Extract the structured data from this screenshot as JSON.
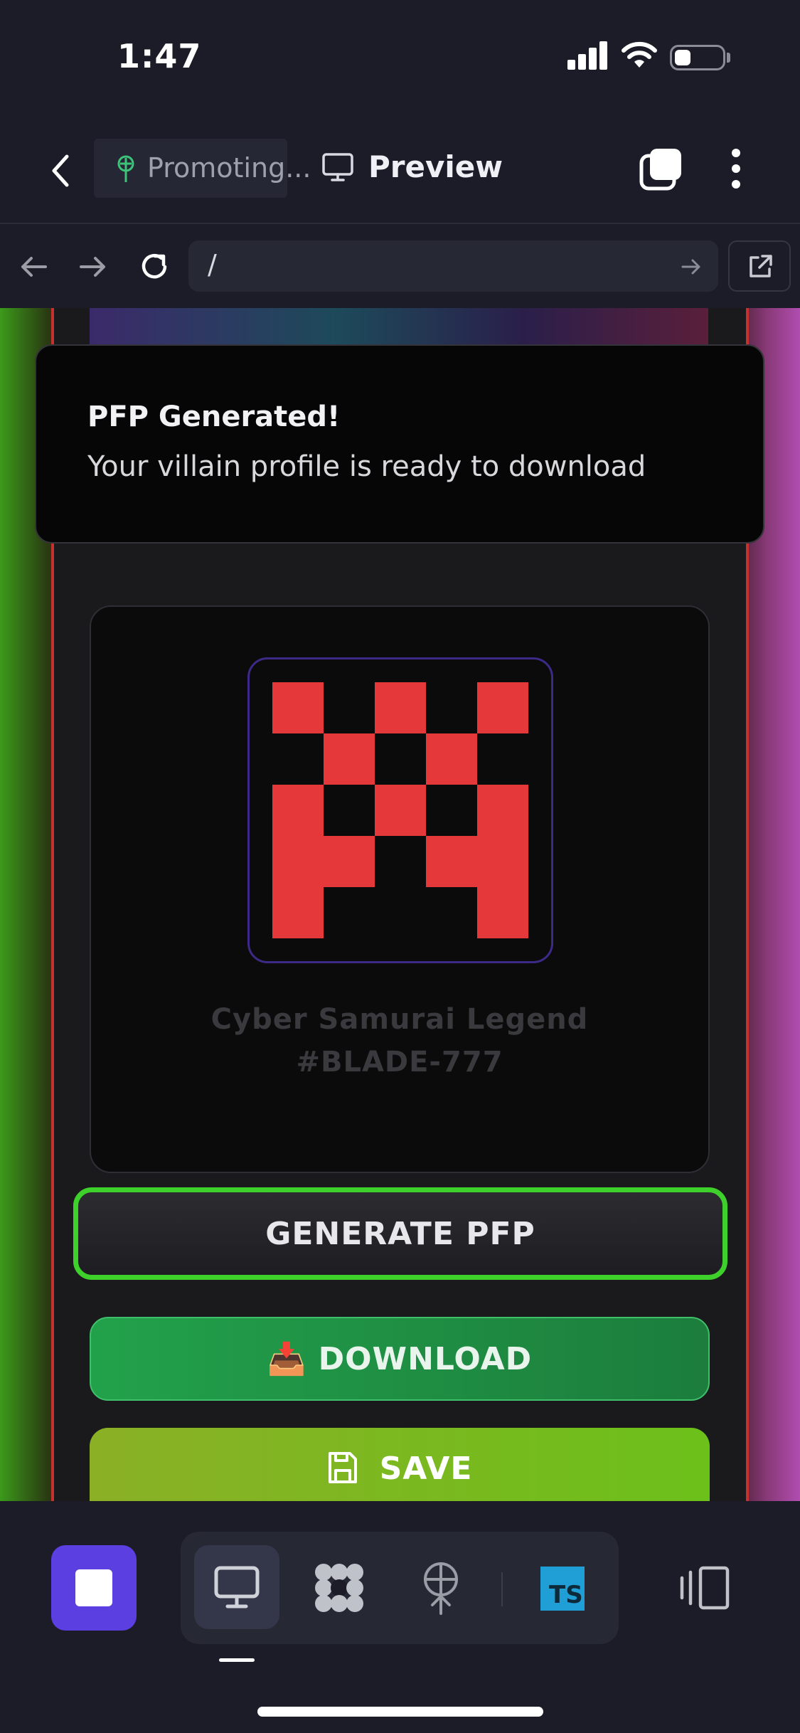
{
  "status_bar": {
    "time": "1:47"
  },
  "header": {
    "project_label": "Promoting...",
    "preview_label": "Preview"
  },
  "browser": {
    "url": "/"
  },
  "toast": {
    "title": "PFP Generated!",
    "message": "Your villain profile is ready to download"
  },
  "pfp": {
    "name": "Cyber Samurai Legend #BLADE-777",
    "pixel_color": "#e5383b",
    "grid": [
      [
        1,
        0,
        1,
        0,
        1
      ],
      [
        0,
        1,
        0,
        1,
        0
      ],
      [
        1,
        0,
        1,
        0,
        1
      ],
      [
        1,
        1,
        0,
        1,
        1
      ],
      [
        1,
        0,
        0,
        0,
        1
      ]
    ]
  },
  "buttons": {
    "generate": "GENERATE PFP",
    "download": "DOWNLOAD",
    "download_emoji": "📥",
    "save": "SAVE"
  },
  "dock": {
    "ts_label": "TS"
  },
  "colors": {
    "accent": "#5b3fe0",
    "generate_border": "#3ed12b",
    "download_bg": "#22a14b",
    "save_bg": "#7cbb1f"
  }
}
